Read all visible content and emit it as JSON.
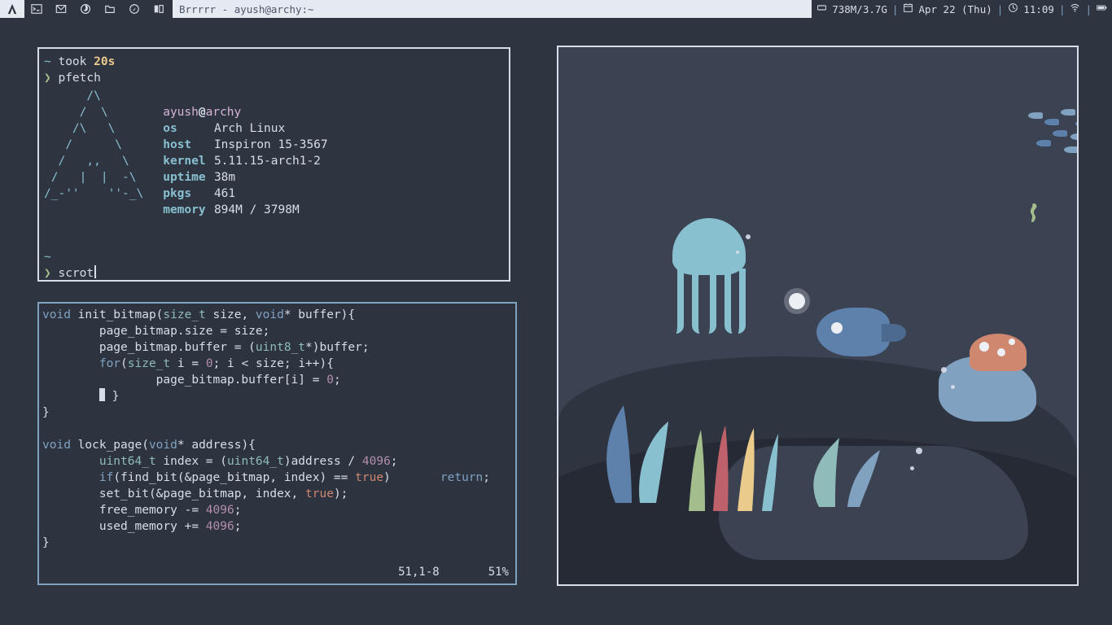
{
  "bar": {
    "title": "Brrrrr - ayush@archy:~",
    "memory": "738M/3.7G",
    "date": "Apr 22 (Thu)",
    "time": "11:09"
  },
  "term": {
    "prompt_path": "~",
    "took_label": "took",
    "took_time": "20s",
    "cmd1": "pfetch",
    "cmd2": "scrot",
    "pfetch_logo": "      /\\\n     /  \\\n    /\\   \\\n   /      \\\n  /   ,,   \\\n /   |  |  -\\\n/_-''    ''-_\\",
    "pfetch_user": "ayush",
    "pfetch_at": "@",
    "pfetch_host": "archy",
    "info": {
      "os": {
        "k": "os",
        "v": "Arch Linux"
      },
      "host": {
        "k": "host",
        "v": "Inspiron 15-3567"
      },
      "kernel": {
        "k": "kernel",
        "v": "5.11.15-arch1-2"
      },
      "uptime": {
        "k": "uptime",
        "v": "38m"
      },
      "pkgs": {
        "k": "pkgs",
        "v": "461"
      },
      "memory": {
        "k": "memory",
        "v": "894M / 3798M"
      }
    }
  },
  "code": {
    "l01a": "void",
    "l01b": " init_bitmap(",
    "l01c": "size_t",
    "l01d": " size, ",
    "l01e": "void",
    "l01f": "* buffer){",
    "l02": "        page_bitmap.size = size;",
    "l03a": "        page_bitmap.buffer = (",
    "l03b": "uint8_t",
    "l03c": "*)buffer;",
    "l04a": "        ",
    "l04b": "for",
    "l04c": "(",
    "l04d": "size_t",
    "l04e": " i = ",
    "l04f": "0",
    "l04g": "; i < size; i++){",
    "l05a": "                page_bitmap.buffer[i] = ",
    "l05b": "0",
    "l05c": ";",
    "l06": "        ",
    "l06b": " }",
    "l07": "}",
    "l08": "",
    "l09a": "void",
    "l09b": " lock_page(",
    "l09c": "void",
    "l09d": "* address){",
    "l10a": "        ",
    "l10b": "uint64_t",
    "l10c": " index = (",
    "l10d": "uint64_t",
    "l10e": ")address / ",
    "l10f": "4096",
    "l10g": ";",
    "l11a": "        ",
    "l11b": "if",
    "l11c": "(find_bit(&page_bitmap, index) == ",
    "l11d": "true",
    "l11e": ")       ",
    "l11f": "return",
    "l11g": ";",
    "l12a": "        set_bit(&page_bitmap, index, ",
    "l12b": "true",
    "l12c": ");",
    "l13a": "        free_memory -= ",
    "l13b": "4096",
    "l13c": ";",
    "l14a": "        used_memory += ",
    "l14b": "4096",
    "l14c": ";",
    "l15": "}",
    "status_pos": "51,1-8",
    "status_pct": "51%"
  }
}
